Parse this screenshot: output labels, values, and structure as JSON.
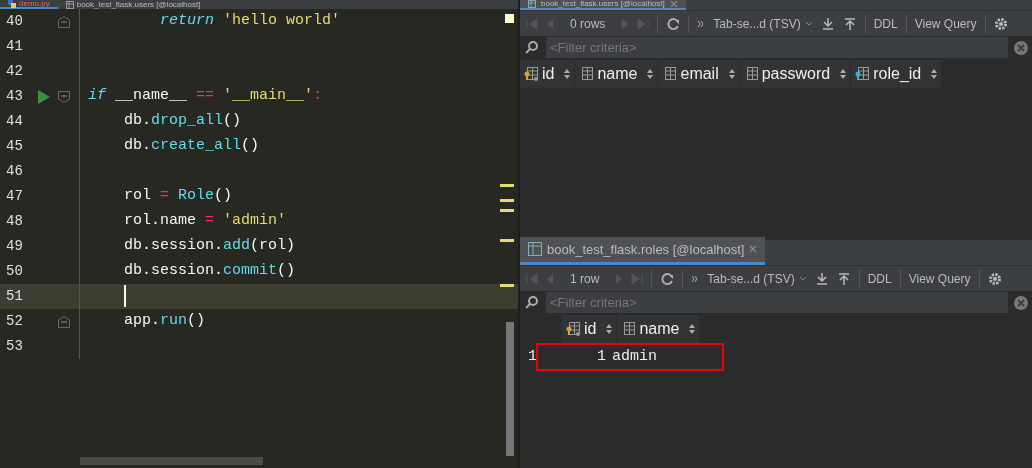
{
  "editor_tabs": [
    {
      "label": "demo.py",
      "kind": "python",
      "selected": true
    },
    {
      "label": "book_test_flask.users [@localhost]",
      "kind": "table",
      "selected": false
    }
  ],
  "editor": {
    "lines": [
      {
        "number": "40",
        "current": false,
        "runnable": false,
        "foldable": true,
        "tokens": [
          {
            "kind": "keyword",
            "text": "        return"
          },
          {
            "kind": "string",
            "text": " 'hello world'"
          }
        ]
      },
      {
        "number": "41",
        "current": false,
        "runnable": false,
        "foldable": false
      },
      {
        "number": "42",
        "current": false,
        "runnable": false,
        "foldable": false
      },
      {
        "number": "43",
        "current": false,
        "runnable": true,
        "foldable": true,
        "tokens": [
          {
            "kind": "keyword",
            "text": "if"
          },
          {
            "kind": "plain",
            "text": " __name__ "
          },
          {
            "kind": "op",
            "text": "=="
          },
          {
            "kind": "string",
            "text": " '__main__'"
          },
          {
            "kind": "op",
            "text": ":"
          }
        ]
      },
      {
        "number": "44",
        "current": false,
        "runnable": false,
        "foldable": false,
        "tokens": [
          {
            "kind": "plain",
            "text": "    db."
          },
          {
            "kind": "func",
            "text": "drop_all"
          },
          {
            "kind": "plain",
            "text": "()"
          }
        ]
      },
      {
        "number": "45",
        "current": false,
        "runnable": false,
        "foldable": false,
        "tokens": [
          {
            "kind": "plain",
            "text": "    db."
          },
          {
            "kind": "func",
            "text": "create_all"
          },
          {
            "kind": "plain",
            "text": "()"
          }
        ]
      },
      {
        "number": "46",
        "current": false,
        "runnable": false,
        "foldable": false
      },
      {
        "number": "47",
        "current": false,
        "runnable": false,
        "foldable": false,
        "tokens": [
          {
            "kind": "plain",
            "text": "    rol "
          },
          {
            "kind": "op",
            "text": "="
          },
          {
            "kind": "func",
            "text": " Role"
          },
          {
            "kind": "plain",
            "text": "()"
          }
        ]
      },
      {
        "number": "48",
        "current": false,
        "runnable": false,
        "foldable": false,
        "tokens": [
          {
            "kind": "plain",
            "text": "    rol.name "
          },
          {
            "kind": "op",
            "text": "="
          },
          {
            "kind": "string",
            "text": " 'admin'"
          }
        ]
      },
      {
        "number": "49",
        "current": false,
        "runnable": false,
        "foldable": false,
        "tokens": [
          {
            "kind": "plain",
            "text": "    db.session."
          },
          {
            "kind": "func",
            "text": "add"
          },
          {
            "kind": "plain",
            "text": "(rol)"
          }
        ]
      },
      {
        "number": "50",
        "current": false,
        "runnable": false,
        "foldable": false,
        "tokens": [
          {
            "kind": "plain",
            "text": "    db.session."
          },
          {
            "kind": "func",
            "text": "commit"
          },
          {
            "kind": "plain",
            "text": "()"
          }
        ]
      },
      {
        "number": "51",
        "current": true,
        "runnable": false,
        "foldable": false
      },
      {
        "number": "52",
        "current": false,
        "runnable": false,
        "foldable": true,
        "tokens": [
          {
            "kind": "plain",
            "text": "    app."
          },
          {
            "kind": "func",
            "text": "run"
          },
          {
            "kind": "plain",
            "text": "()"
          }
        ]
      },
      {
        "number": "53",
        "current": false,
        "runnable": false,
        "foldable": false
      }
    ]
  },
  "panels": [
    {
      "tab": {
        "label": "book_test_flask.users [@localhost]",
        "selected": true
      },
      "rows_count": "0 rows",
      "format": "Tab-se...d (TSV)",
      "ddl": "DDL",
      "view_query": "View Query",
      "filter_placeholder": "<Filter criteria>",
      "columns": [
        {
          "label": "id",
          "kind": "key"
        },
        {
          "label": "name",
          "kind": "plain"
        },
        {
          "label": "email",
          "kind": "plain"
        },
        {
          "label": "password",
          "kind": "plain"
        },
        {
          "label": "role_id",
          "kind": "foreign_key"
        }
      ]
    },
    {
      "tab": {
        "label": "book_test_flask.roles [@localhost]",
        "selected": true
      },
      "rows_count": "1 row",
      "format": "Tab-se...d (TSV)",
      "ddl": "DDL",
      "view_query": "View Query",
      "filter_placeholder": "<Filter criteria>",
      "columns": [
        {
          "label": "id",
          "kind": "key"
        },
        {
          "label": "name",
          "kind": "plain"
        }
      ],
      "rows": [
        {
          "number": "1",
          "highlighted": true,
          "cells": [
            "1",
            "admin"
          ]
        }
      ]
    }
  ]
}
